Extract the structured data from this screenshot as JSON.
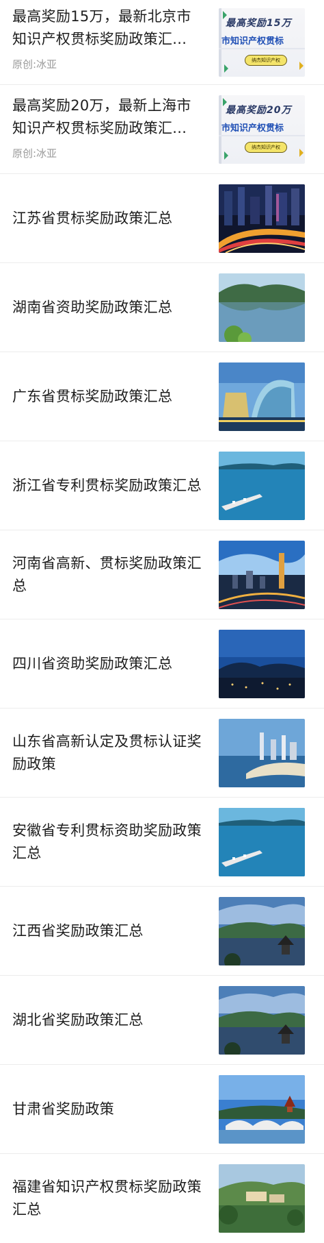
{
  "articles": [
    {
      "title": "最高奖励15万，最新北京市知识产权贯标奖励政策汇...",
      "source": "原创:冰亚",
      "banner": {
        "line1": "最高奖励15万",
        "line2": "市知识产权贯标",
        "button": "纳杰知识产权"
      }
    },
    {
      "title": "最高奖励20万，最新上海市知识产权贯标奖励政策汇...",
      "source": "原创:冰亚",
      "banner": {
        "line1": "最高奖励20万",
        "line2": "市知识产权贯标",
        "button": "纳杰知识产权"
      }
    },
    {
      "title": "江苏省贯标奖励政策汇总",
      "thumb_icon": "city-night-photo"
    },
    {
      "title": "湖南省资助奖励政策汇总",
      "thumb_icon": "lake-mountain-photo"
    },
    {
      "title": "广东省贯标奖励政策汇总",
      "thumb_icon": "building-night-photo"
    },
    {
      "title": "浙江省专利贯标奖励政策汇总",
      "thumb_icon": "lake-pier-photo"
    },
    {
      "title": "河南省高新、贯标奖励政策汇总",
      "thumb_icon": "city-sunset-photo"
    },
    {
      "title": "四川省资助奖励政策汇总",
      "thumb_icon": "mountain-town-night-photo"
    },
    {
      "title": "山东省高新认定及贯标认证奖励政策",
      "thumb_icon": "coastal-city-photo"
    },
    {
      "title": "安徽省专利贯标资助奖励政策汇总",
      "thumb_icon": "lake-pier-photo"
    },
    {
      "title": "江西省奖励政策汇总",
      "thumb_icon": "pavilion-lake-photo"
    },
    {
      "title": "湖北省奖励政策汇总",
      "thumb_icon": "pavilion-lake-photo"
    },
    {
      "title": "甘肃省奖励政策",
      "thumb_icon": "bridge-pagoda-photo"
    },
    {
      "title": "福建省知识产权贯标奖励政策汇总",
      "thumb_icon": "hill-village-photo"
    }
  ]
}
